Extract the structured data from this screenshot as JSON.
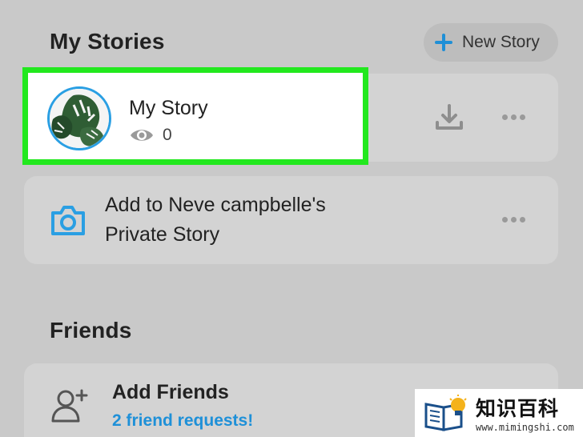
{
  "my_stories": {
    "title": "My Stories",
    "new_story_label": "New Story",
    "story": {
      "name": "My Story",
      "views": "0"
    },
    "private_story": {
      "line1": "Add to Neve campbelle's",
      "line2": "Private Story"
    }
  },
  "friends": {
    "title": "Friends",
    "add_friends_label": "Add Friends",
    "requests_label": "2 friend requests!"
  },
  "watermark": {
    "text": "知识百科",
    "url": "www.mimingshi.com"
  },
  "colors": {
    "accent": "#1f8fd6",
    "highlight": "#22e81e",
    "background": "#c9c9c9"
  }
}
